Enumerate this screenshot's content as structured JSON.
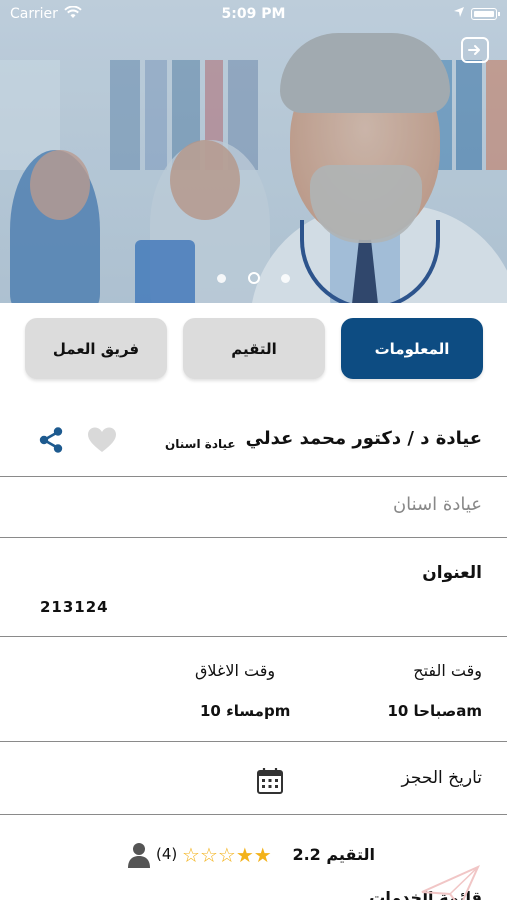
{
  "status_bar": {
    "carrier": "Carrier",
    "time": "5:09 PM"
  },
  "hero": {
    "page_count": 3,
    "active_page": 2
  },
  "tabs": [
    {
      "label": "المعلومات",
      "active": true
    },
    {
      "label": "التقيم",
      "active": false
    },
    {
      "label": "فريق العمل",
      "active": false
    }
  ],
  "clinic": {
    "title": "عيادة د / دكتور محمد عدلي",
    "type_small": "عيادة اسنان",
    "specialty": "عيادة اسنان"
  },
  "address": {
    "label": "العنوان",
    "value": "213124"
  },
  "hours": {
    "open_label": "وقت الفتح",
    "close_label": "وقت الاغلاق",
    "open_value": "صباحا 10am",
    "close_value": "مساء 10pm"
  },
  "booking": {
    "label": "تاريخ الحجز"
  },
  "rating": {
    "label": "التقيم 2.2",
    "value": 2.2,
    "max": 5,
    "count_text": "(4)"
  },
  "cutoff": {
    "text": "قائمة الخدمات"
  },
  "colors": {
    "primary": "#0d4c82",
    "tab_inactive": "#dcdcdc",
    "star": "#f3b21a",
    "share_icon": "#1d5a8f"
  }
}
